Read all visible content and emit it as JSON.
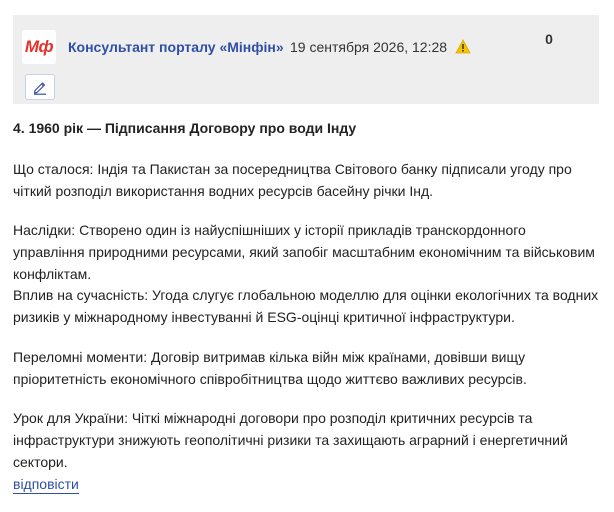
{
  "comment": {
    "logo_text": "Мф",
    "author": "Консультант порталу «Мінфін»",
    "date": "19 сентября 2026, 12:28",
    "rating": "0",
    "title": "4. 1960 рік — Підписання Договору про води Інду",
    "paragraphs": [
      "Що сталося: Індія та Пакистан за посередництва Світового банку підписали угоду про чіткий розподіл використання водних ресурсів басейну річки Інд.",
      "Наслідки: Створено один із найуспішніших у історії прикладів транскордонного управління природними ресурсами, який запобіг масштабним економічним та військовим конфліктам.",
      "Вплив на сучасність: Угода слугує глобальною моделлю для оцінки екологічних та водних ризиків у міжнародному інвестуванні й ESG-оцінці критичної інфраструктури.",
      "Переломні моменти: Договір витримав кілька війн між країнами, довівши вищу пріоритетність економічного співробітництва щодо життєво важливих ресурсів.",
      "Урок для України: Чіткі міжнародні договори про розподіл критичних ресурсів та інфраструктури знижують геополітичні ризики та захищають аграрний і енергетичний сектори."
    ],
    "reply_label": "відповісти"
  },
  "icons": {
    "warning": "warning-icon",
    "edit": "pencil-icon"
  },
  "colors": {
    "brand_red": "#e4322b",
    "link_blue": "#2f4ea6",
    "warning_yellow": "#f5c400",
    "header_bg": "#eeeeee"
  }
}
